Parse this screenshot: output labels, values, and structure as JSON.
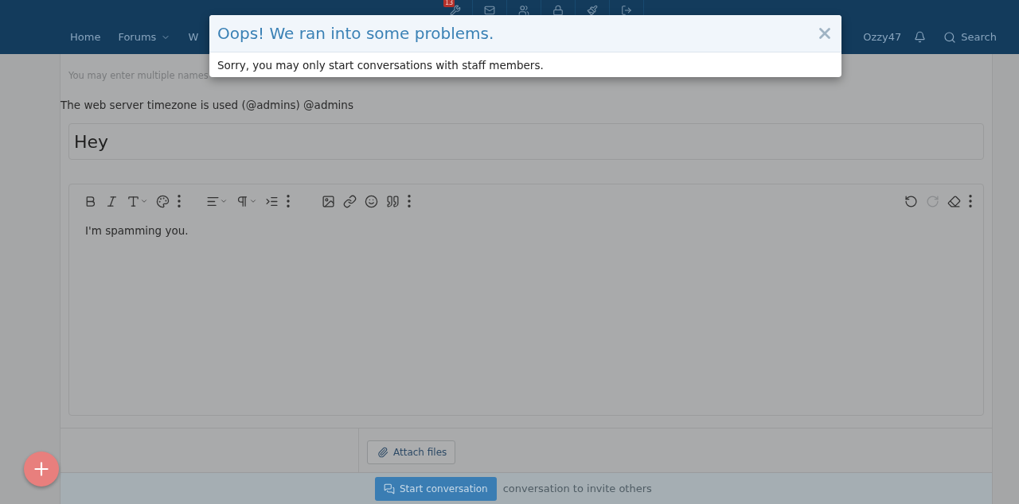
{
  "header": {
    "admin_badge": "13",
    "nav": [
      {
        "label": "Home",
        "dropdown": false
      },
      {
        "label": "Forums",
        "dropdown": true
      },
      {
        "label": "W",
        "dropdown": false
      }
    ],
    "user": "Ozzy47",
    "search": "Search"
  },
  "form": {
    "recipients_hint": "You may enter multiple names",
    "timezone_note": "The web server timezone is used (@admins) @admins",
    "title_value": "Hey",
    "body": "I'm spamming you.",
    "attach": "Attach files",
    "submit": "Start conversation",
    "option_label": "conversation to invite others"
  },
  "toolbar": {
    "redo_disabled": true
  },
  "modal": {
    "title": "Oops! We ran into some problems.",
    "message": "Sorry, you may only start conversations with staff members."
  }
}
